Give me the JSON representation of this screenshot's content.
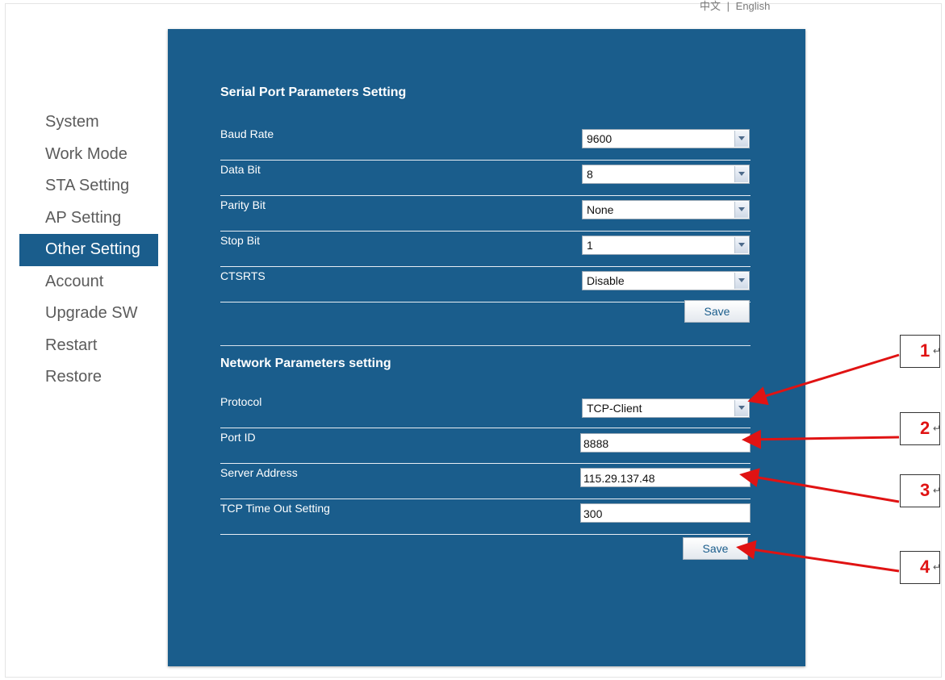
{
  "language_links": [
    "中文",
    "|",
    "English"
  ],
  "nav": {
    "items": [
      {
        "label": "System"
      },
      {
        "label": "Work Mode"
      },
      {
        "label": "STA Setting"
      },
      {
        "label": "AP Setting"
      },
      {
        "label": "Other Setting",
        "active": true
      },
      {
        "label": "Account"
      },
      {
        "label": "Upgrade SW"
      },
      {
        "label": "Restart"
      },
      {
        "label": "Restore"
      }
    ]
  },
  "serial": {
    "title": "Serial Port Parameters Setting",
    "rows": [
      {
        "label": "Baud Rate",
        "value": "9600"
      },
      {
        "label": "Data Bit",
        "value": "8"
      },
      {
        "label": "Parity Bit",
        "value": "None"
      },
      {
        "label": "Stop Bit",
        "value": "1"
      },
      {
        "label": "CTSRTS",
        "value": "Disable"
      }
    ],
    "save_label": "Save"
  },
  "network": {
    "title": "Network Parameters setting",
    "rows": [
      {
        "label": "Protocol",
        "value": "TCP-Client"
      },
      {
        "label": "Port ID",
        "value": "8888"
      },
      {
        "label": "Server Address",
        "value": "115.29.137.48"
      },
      {
        "label": "TCP Time Out Setting",
        "value": "300"
      }
    ],
    "save_label": "Save"
  },
  "callouts": [
    {
      "num": "1",
      "mark": "↵"
    },
    {
      "num": "2",
      "mark": "↵"
    },
    {
      "num": "3",
      "mark": "↵"
    },
    {
      "num": "4",
      "mark": "↵"
    }
  ],
  "colors": {
    "panel": "#1a5d8c",
    "nav_active": "#1a5d8c",
    "callout_arrow": "#e01313"
  }
}
